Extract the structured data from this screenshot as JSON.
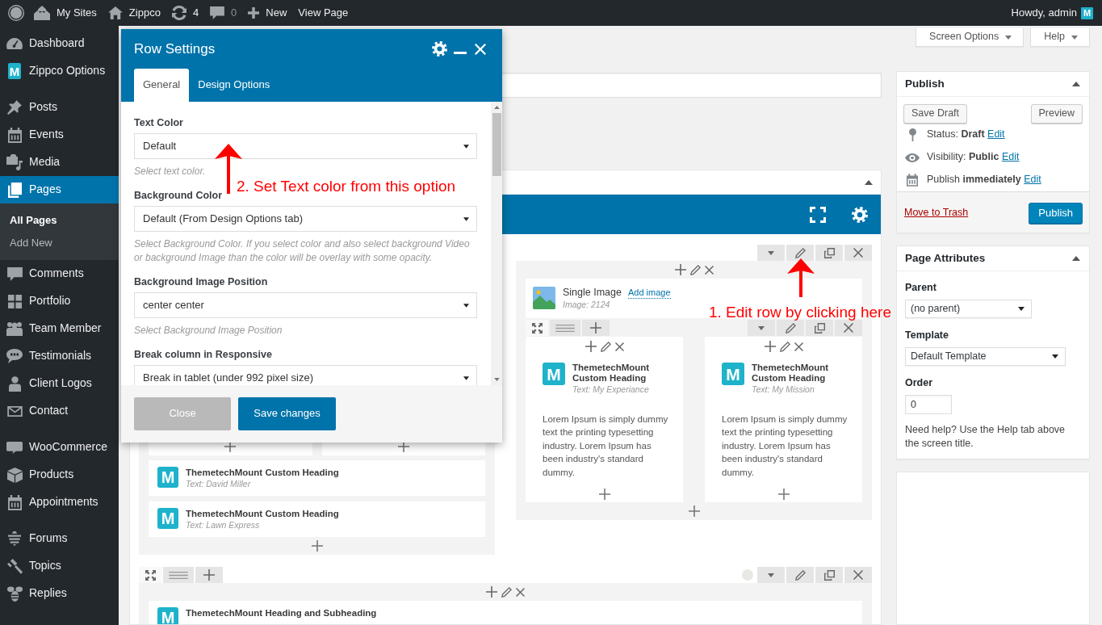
{
  "admin_bar": {
    "items": [
      {
        "label": "My Sites",
        "muted": false
      },
      {
        "label": "Zippco",
        "muted": false
      },
      {
        "label": "4",
        "muted": false
      },
      {
        "label": "0",
        "muted": true
      },
      {
        "label": "New",
        "muted": false
      },
      {
        "label": "View Page",
        "muted": false
      }
    ],
    "greeting": "Howdy, admin",
    "avatar_text": "M"
  },
  "sidebar": {
    "groups": [
      {
        "items": [
          {
            "label": "Dashboard",
            "selected": false
          },
          {
            "label": "Zippco Options",
            "selected": false,
            "icon_text": "M"
          }
        ]
      },
      {
        "items": [
          {
            "label": "Posts",
            "selected": false
          },
          {
            "label": "Events",
            "selected": false
          },
          {
            "label": "Media",
            "selected": false
          },
          {
            "label": "Pages",
            "selected": true,
            "children": [
              {
                "label": "All Pages",
                "selected": true
              },
              {
                "label": "Add New",
                "selected": false
              }
            ]
          },
          {
            "label": "Comments",
            "selected": false
          },
          {
            "label": "Portfolio",
            "selected": false
          },
          {
            "label": "Team Member",
            "selected": false
          },
          {
            "label": "Testimonials",
            "selected": false
          },
          {
            "label": "Client Logos",
            "selected": false
          },
          {
            "label": "Contact",
            "selected": false
          }
        ]
      },
      {
        "items": [
          {
            "label": "WooCommerce",
            "selected": false
          },
          {
            "label": "Products",
            "selected": false
          },
          {
            "label": "Appointments",
            "selected": false
          }
        ]
      },
      {
        "items": [
          {
            "label": "Forums",
            "selected": false
          },
          {
            "label": "Topics",
            "selected": false
          },
          {
            "label": "Replies",
            "selected": false
          }
        ]
      }
    ]
  },
  "screen_meta": {
    "tabs": [
      "Screen Options",
      "Help"
    ]
  },
  "modal": {
    "title": "Row Settings",
    "tabs": [
      {
        "label": "General",
        "selected": true
      },
      {
        "label": "Design Options",
        "selected": false
      }
    ],
    "fields": [
      {
        "label": "Text Color",
        "value": "Default",
        "hint": "Select text color."
      },
      {
        "label": "Background Color",
        "value": "Default (From Design Options tab)",
        "hint": "Select Background Color. If you select color and also select background Video or background Image than the color will be overlay with some opacity."
      },
      {
        "label": "Background Image Position",
        "value": "center center",
        "hint": "Select Background Image Position"
      },
      {
        "label": "Break column in Responsive",
        "value": "Break in tablet (under 992 pixel size)"
      }
    ],
    "buttons": [
      {
        "kind": "secondary",
        "label": "Close"
      },
      {
        "kind": "primary",
        "label": "Save changes"
      }
    ]
  },
  "builder": {
    "expanded": true,
    "rows": [
      {
        "kind": "partial",
        "indicator": false,
        "columns": [
          {
            "kind": "partial",
            "elements": [
              {
                "kind": "inner_row_end"
              },
              {
                "kind": "heading",
                "icon_text": "M",
                "title": "ThemetechMount Custom Heading",
                "subtitle": "Text: David Miller"
              },
              {
                "kind": "heading",
                "icon_text": "M",
                "title": "ThemetechMount Custom Heading",
                "subtitle": "Text: Lawn Express"
              }
            ]
          },
          {
            "kind": "full",
            "elements": [
              {
                "kind": "image",
                "title": "Single Image",
                "link": "Add image",
                "subtitle": "Image: 2124"
              },
              {
                "kind": "inner_row",
                "columns": [
                  {
                    "elements": [
                      {
                        "kind": "heading",
                        "icon_text": "M",
                        "title": "ThemetechMount Custom Heading",
                        "subtitle": "Text: My Experiance"
                      },
                      {
                        "kind": "text",
                        "text": "Lorem Ipsum is simply dummy text the printing typesetting industry. Lorem Ipsum has been industry's standard dummy."
                      }
                    ]
                  },
                  {
                    "elements": [
                      {
                        "kind": "heading",
                        "icon_text": "M",
                        "title": "ThemetechMount Custom Heading",
                        "subtitle": "Text: My Mission"
                      },
                      {
                        "kind": "text",
                        "text": "Lorem Ipsum is simply dummy text the printing typesetting industry. Lorem Ipsum has been industry's standard dummy."
                      }
                    ]
                  }
                ]
              }
            ]
          }
        ]
      },
      {
        "kind": "full",
        "indicator": true,
        "columns": [
          {
            "kind": "cut",
            "elements": [
              {
                "kind": "heading",
                "icon_text": "M",
                "title": "ThemetechMount Heading and Subheading"
              }
            ]
          }
        ]
      }
    ]
  },
  "publish": {
    "title": "Publish",
    "expanded": true,
    "actions": [
      "Save Draft",
      "Preview"
    ],
    "meta": [
      {
        "text": "Status: **Draft**",
        "link": "Edit"
      },
      {
        "text": "Visibility: **Public**",
        "link": "Edit"
      },
      {
        "text": "Publish **immediately**",
        "link": "Edit"
      }
    ],
    "trash": "Move to Trash",
    "submit": "Publish"
  },
  "page_attributes": {
    "title": "Page Attributes",
    "expanded": true,
    "fields": [
      {
        "kind": "select",
        "label": "Parent",
        "value": "(no parent)"
      },
      {
        "kind": "select",
        "label": "Template",
        "value": "Default Template"
      },
      {
        "kind": "input",
        "label": "Order",
        "value": "0"
      }
    ],
    "help": "Need help? Use the Help tab above the screen title."
  },
  "annotations": [
    {
      "text": "2. Set Text color from this option"
    },
    {
      "text": "1. Edit row by clicking here"
    }
  ]
}
